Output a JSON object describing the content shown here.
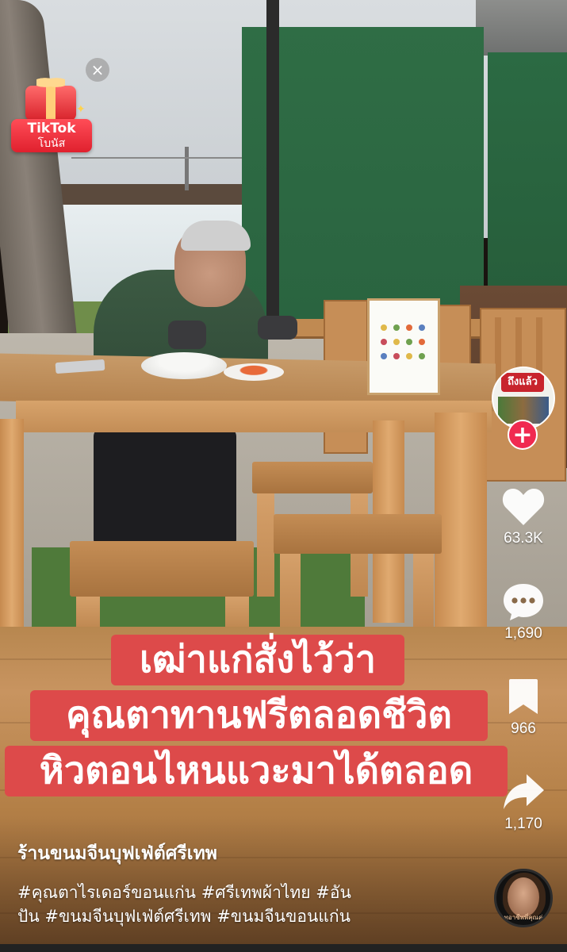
{
  "bonus_widget": {
    "line1": "TikTok",
    "line2": "โบนัส",
    "close_glyph": "×",
    "icon": "gift-icon"
  },
  "video": {
    "caption_lines": [
      "เฒ่าแก่สั่งไว้ว่า",
      "คุณตาทานฟรีตลอดชีวิต",
      "หิวตอนไหนแวะมาได้ตลอด"
    ],
    "caption_bg": "#dd4a4a",
    "menu_stand_text": "",
    "shop_avatar_banner": "ถึงแล้ว"
  },
  "side_rail": {
    "follow_glyph": "+",
    "like": {
      "icon": "heart-icon",
      "count": "63.3K"
    },
    "comment": {
      "icon": "comment-icon",
      "count": "1,690"
    },
    "save": {
      "icon": "bookmark-icon",
      "count": "966"
    },
    "share": {
      "icon": "share-icon",
      "count": "1,170"
    }
  },
  "post": {
    "account_name": "ร้านขนมจีนบุฟเฟ่ต์ศรีเทพ",
    "hashtag_lines": [
      "#คุณตาไรเดอร์ขอนแก่น #ศรีเทพผ้าไทย #อัน",
      "ปัน #ขนมจีนบุฟเฟ่ต์ศรีเทพ #ขนมจีนขอนแก่น"
    ],
    "music_disc_text": "ทอาชีพพี่คุณค่"
  },
  "colors": {
    "follow_plus": "#f02a50",
    "bonus_red": "#e0202e",
    "icon_white": "#ffffff"
  }
}
